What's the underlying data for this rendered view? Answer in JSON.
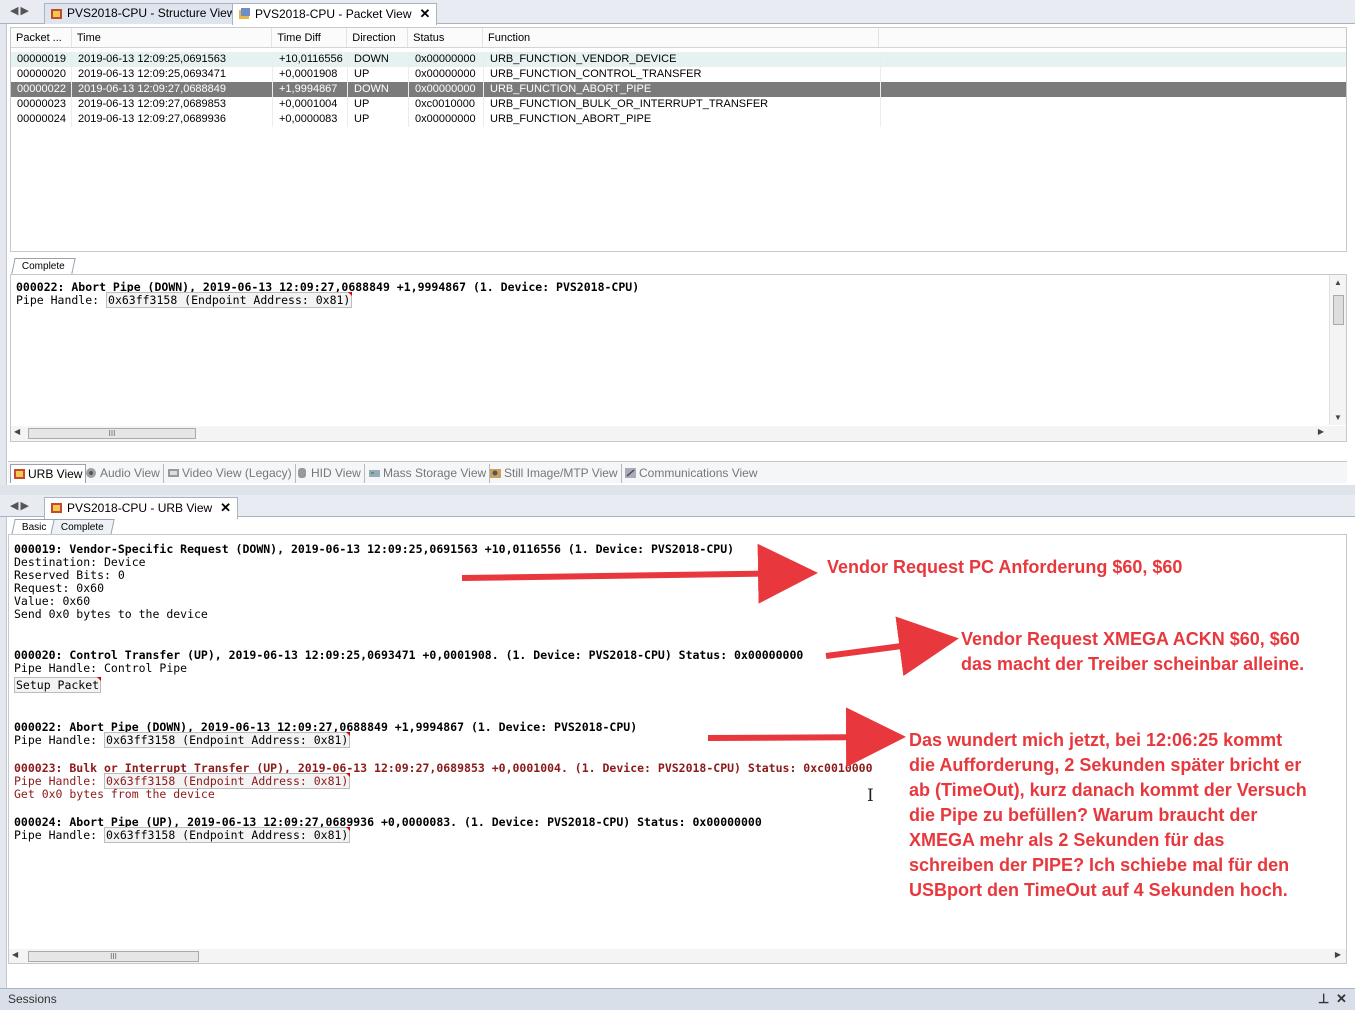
{
  "top_tabs": [
    {
      "label": "PVS2018-CPU - Structure View",
      "icon": "structure-view-icon"
    },
    {
      "label": "PVS2018-CPU - Packet View",
      "icon": "packet-view-icon",
      "close": "✕"
    }
  ],
  "packet_table": {
    "columns": [
      "Packet ...",
      "Time",
      "Time Diff",
      "Direction",
      "Status",
      "Function"
    ],
    "rows": [
      [
        "00000019",
        "2019-06-13 12:09:25,0691563",
        "+10,0116556",
        "DOWN",
        "0x00000000",
        "URB_FUNCTION_VENDOR_DEVICE"
      ],
      [
        "00000020",
        "2019-06-13 12:09:25,0693471",
        "+0,0001908",
        "UP",
        "0x00000000",
        "URB_FUNCTION_CONTROL_TRANSFER"
      ],
      [
        "00000022",
        "2019-06-13 12:09:27,0688849",
        "+1,9994867",
        "DOWN",
        "0x00000000",
        "URB_FUNCTION_ABORT_PIPE"
      ],
      [
        "00000023",
        "2019-06-13 12:09:27,0689853",
        "+0,0001004",
        "UP",
        "0xc0010000",
        "URB_FUNCTION_BULK_OR_INTERRUPT_TRANSFER"
      ],
      [
        "00000024",
        "2019-06-13 12:09:27,0689936",
        "+0,0000083",
        "UP",
        "0x00000000",
        "URB_FUNCTION_ABORT_PIPE"
      ]
    ]
  },
  "detail": {
    "tab": "Complete",
    "title": "000022: Abort Pipe (DOWN), 2019-06-13 12:09:27,0688849 +1,9994867 (1. Device: PVS2018-CPU)",
    "pipe_label": "Pipe Handle: ",
    "pipe_value": "0x63ff3158 (Endpoint Address: 0x81)"
  },
  "scroll_grip": "III",
  "view_tabs": [
    {
      "label": "URB View",
      "icon": "urb-view-icon"
    },
    {
      "label": "Audio View",
      "icon": "audio-view-icon"
    },
    {
      "label": "Video View (Legacy)",
      "icon": "video-view-icon"
    },
    {
      "label": "HID View",
      "icon": "hid-view-icon"
    },
    {
      "label": "Mass Storage View",
      "icon": "mass-storage-view-icon"
    },
    {
      "label": "Still Image/MTP View",
      "icon": "still-image-view-icon"
    },
    {
      "label": "Communications View",
      "icon": "communications-view-icon"
    }
  ],
  "urb_tab": {
    "label": "PVS2018-CPU - URB View",
    "close": "✕"
  },
  "urb_subtabs": [
    "Basic",
    "Complete"
  ],
  "urb": {
    "p19": {
      "title": "000019: Vendor-Specific Request (DOWN), 2019-06-13 12:09:25,0691563 +10,0116556 (1. Device: PVS2018-CPU)",
      "lines": [
        "Destination: Device",
        "Reserved Bits: 0",
        "Request: 0x60",
        "Value: 0x60",
        "Send 0x0 bytes to the device"
      ]
    },
    "p20": {
      "title": "000020: Control Transfer (UP), 2019-06-13 12:09:25,0693471 +0,0001908. (1. Device: PVS2018-CPU) Status: 0x00000000",
      "pipe": "Pipe Handle: Control Pipe",
      "setup": "Setup Packet"
    },
    "p22": {
      "title": "000022: Abort Pipe (DOWN), 2019-06-13 12:09:27,0688849 +1,9994867 (1. Device: PVS2018-CPU)",
      "pipe_label": "Pipe Handle: ",
      "pipe_value": "0x63ff3158 (Endpoint Address: 0x81)"
    },
    "p23": {
      "title": "000023: Bulk or Interrupt Transfer (UP), 2019-06-13 12:09:27,0689853 +0,0001004. (1. Device: PVS2018-CPU) Status: 0xc0010000",
      "pipe_label": "Pipe Handle: ",
      "pipe_value": "0x63ff3158 (Endpoint Address: 0x81)",
      "extra": "Get 0x0 bytes from the device"
    },
    "p24": {
      "title": "000024: Abort Pipe (UP), 2019-06-13 12:09:27,0689936 +0,0000083. (1. Device: PVS2018-CPU) Status: 0x00000000",
      "pipe_label": "Pipe Handle: ",
      "pipe_value": "0x63ff3158 (Endpoint Address: 0x81)"
    }
  },
  "annotations": {
    "a1": "Vendor Request PC Anforderung $60, $60",
    "a2": [
      "Vendor Request XMEGA ACKN  $60, $60",
      "das macht der Treiber scheinbar alleine."
    ],
    "a3": [
      "Das wundert  mich jetzt, bei 12:06:25 kommt",
      "die Aufforderung, 2 Sekunden später bricht er",
      "ab (TimeOut), kurz danach kommt der Versuch",
      "die Pipe zu befüllen? Warum braucht der",
      "XMEGA mehr als 2 Sekunden für das",
      "schreiben der PIPE? Ich schiebe mal für den",
      "USBport den TimeOut auf 4 Sekunden hoch."
    ],
    "color": "#e8383d"
  },
  "sessions": {
    "label": "Sessions",
    "pin": "⊥",
    "close": "✕"
  },
  "colors": {
    "selected_row": "#7b7b7b",
    "highlight_row": "#e6f2f2",
    "error_text": "#8b1a1a"
  }
}
